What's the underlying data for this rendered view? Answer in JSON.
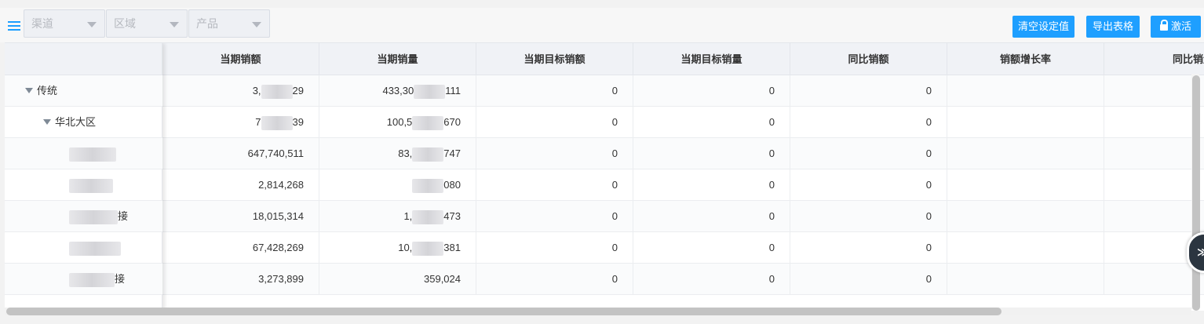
{
  "filters": [
    {
      "placeholder": "渠道"
    },
    {
      "placeholder": "区域"
    },
    {
      "placeholder": "产品"
    }
  ],
  "buttons": {
    "clear": "清空设定值",
    "export": "导出表格",
    "activate": "激活"
  },
  "columns": [
    "当期销额",
    "当期销量",
    "当期目标销额",
    "当期目标销量",
    "同比销额",
    "销额增长率",
    "同比销量"
  ],
  "rows": [
    {
      "label": "传统",
      "level": 0,
      "expanded": true,
      "label_tail": "",
      "values": [
        "3,[blurred]29",
        "433,30[blurred]111",
        "0",
        "0",
        "0",
        "",
        ""
      ]
    },
    {
      "label": "华北大区",
      "level": 1,
      "expanded": true,
      "label_tail": "",
      "values": [
        "7[blurred]39",
        "100,5[blurred]670",
        "0",
        "0",
        "0",
        "",
        ""
      ]
    },
    {
      "label": "",
      "level": 2,
      "expanded": false,
      "label_tail": "",
      "values": [
        "647,740,511",
        "83,[blurred]747",
        "0",
        "0",
        "0",
        "",
        ""
      ]
    },
    {
      "label": "",
      "level": 2,
      "expanded": false,
      "label_tail": "",
      "values": [
        "2,814,268",
        "[blurred]080",
        "0",
        "0",
        "0",
        "",
        ""
      ]
    },
    {
      "label": "",
      "level": 2,
      "expanded": false,
      "label_tail": "接",
      "values": [
        "18,015,314",
        "1,[blurred]473",
        "0",
        "0",
        "0",
        "",
        ""
      ]
    },
    {
      "label": "",
      "level": 2,
      "expanded": false,
      "label_tail": "",
      "values": [
        "67,428,269",
        "10,[blurred]381",
        "0",
        "0",
        "0",
        "",
        ""
      ]
    },
    {
      "label": "",
      "level": 2,
      "expanded": false,
      "label_tail": "接",
      "values": [
        "3,273,899",
        "359,024",
        "0",
        "0",
        "0",
        "",
        ""
      ]
    }
  ],
  "colors": {
    "accent": "#1e9fff",
    "header_bg": "#f0f2f6"
  },
  "icons": {
    "menu": "hamburger-menu-icon",
    "caret": "caret-down-icon",
    "lock": "unlock-icon",
    "expand": "triangle-down-icon"
  }
}
